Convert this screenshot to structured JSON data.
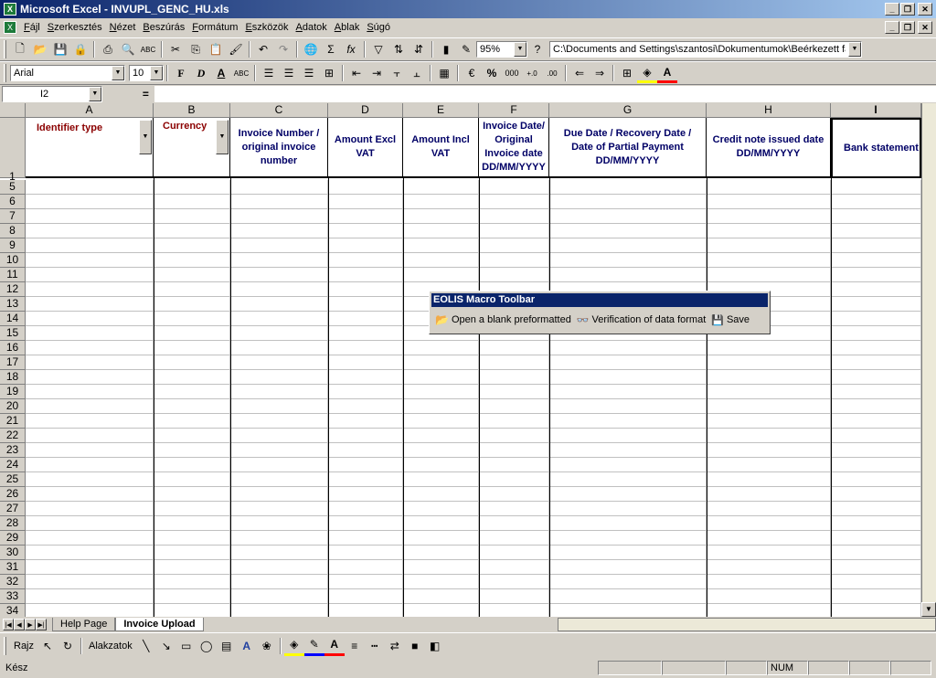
{
  "window": {
    "title": "Microsoft Excel - INVUPL_GENC_HU.xls"
  },
  "menu": [
    "Fájl",
    "Szerkesztés",
    "Nézet",
    "Beszúrás",
    "Formátum",
    "Eszközök",
    "Adatok",
    "Ablak",
    "Súgó"
  ],
  "standard_toolbar": {
    "zoom": "95%",
    "path": "C:\\Documents and Settings\\szantosi\\Dokumentumok\\Beérkezett fá"
  },
  "formatting_toolbar": {
    "font": "Arial",
    "size": "10",
    "bold": "F",
    "italic": "D",
    "underline": "A",
    "percent": "%",
    "thousands": "000"
  },
  "formula_bar": {
    "name_box": "I2",
    "equals": "="
  },
  "columns": [
    "A",
    "B",
    "C",
    "D",
    "E",
    "F",
    "G",
    "H",
    "I"
  ],
  "header_row_label": "1",
  "header_cells": [
    "Identifier type",
    "Currency",
    "Invoice Number / original invoice number",
    "Amount Excl VAT",
    "Amount Incl VAT",
    "Invoice Date/ Original Invoice date DD/MM/YYYY",
    "Due Date / Recovery Date / Date of Partial Payment DD/MM/YYYY",
    "Credit note issued date DD/MM/YYYY",
    "Bank statement"
  ],
  "row_numbers": [
    "5",
    "6",
    "7",
    "8",
    "9",
    "10",
    "11",
    "12",
    "13",
    "14",
    "15",
    "16",
    "17",
    "18",
    "19",
    "20",
    "21",
    "22",
    "23",
    "24",
    "25",
    "26",
    "27",
    "28",
    "29",
    "30",
    "31",
    "32",
    "33",
    "34"
  ],
  "macro_toolbar": {
    "title": "EOLIS Macro Toolbar",
    "open_label": "Open a blank preformatted",
    "verify_label": "Verification of data format",
    "save_label": "Save"
  },
  "sheet_tabs": {
    "help": "Help Page",
    "upload": "Invoice Upload"
  },
  "drawing_toolbar": {
    "draw": "Rajz",
    "autoshapes": "Alakzatok"
  },
  "status": {
    "ready": "Kész",
    "num": "NUM"
  },
  "colors": {
    "titlebar": "#0a246a",
    "header_text_red": "#8b0000",
    "header_text_blue": "#000066"
  }
}
